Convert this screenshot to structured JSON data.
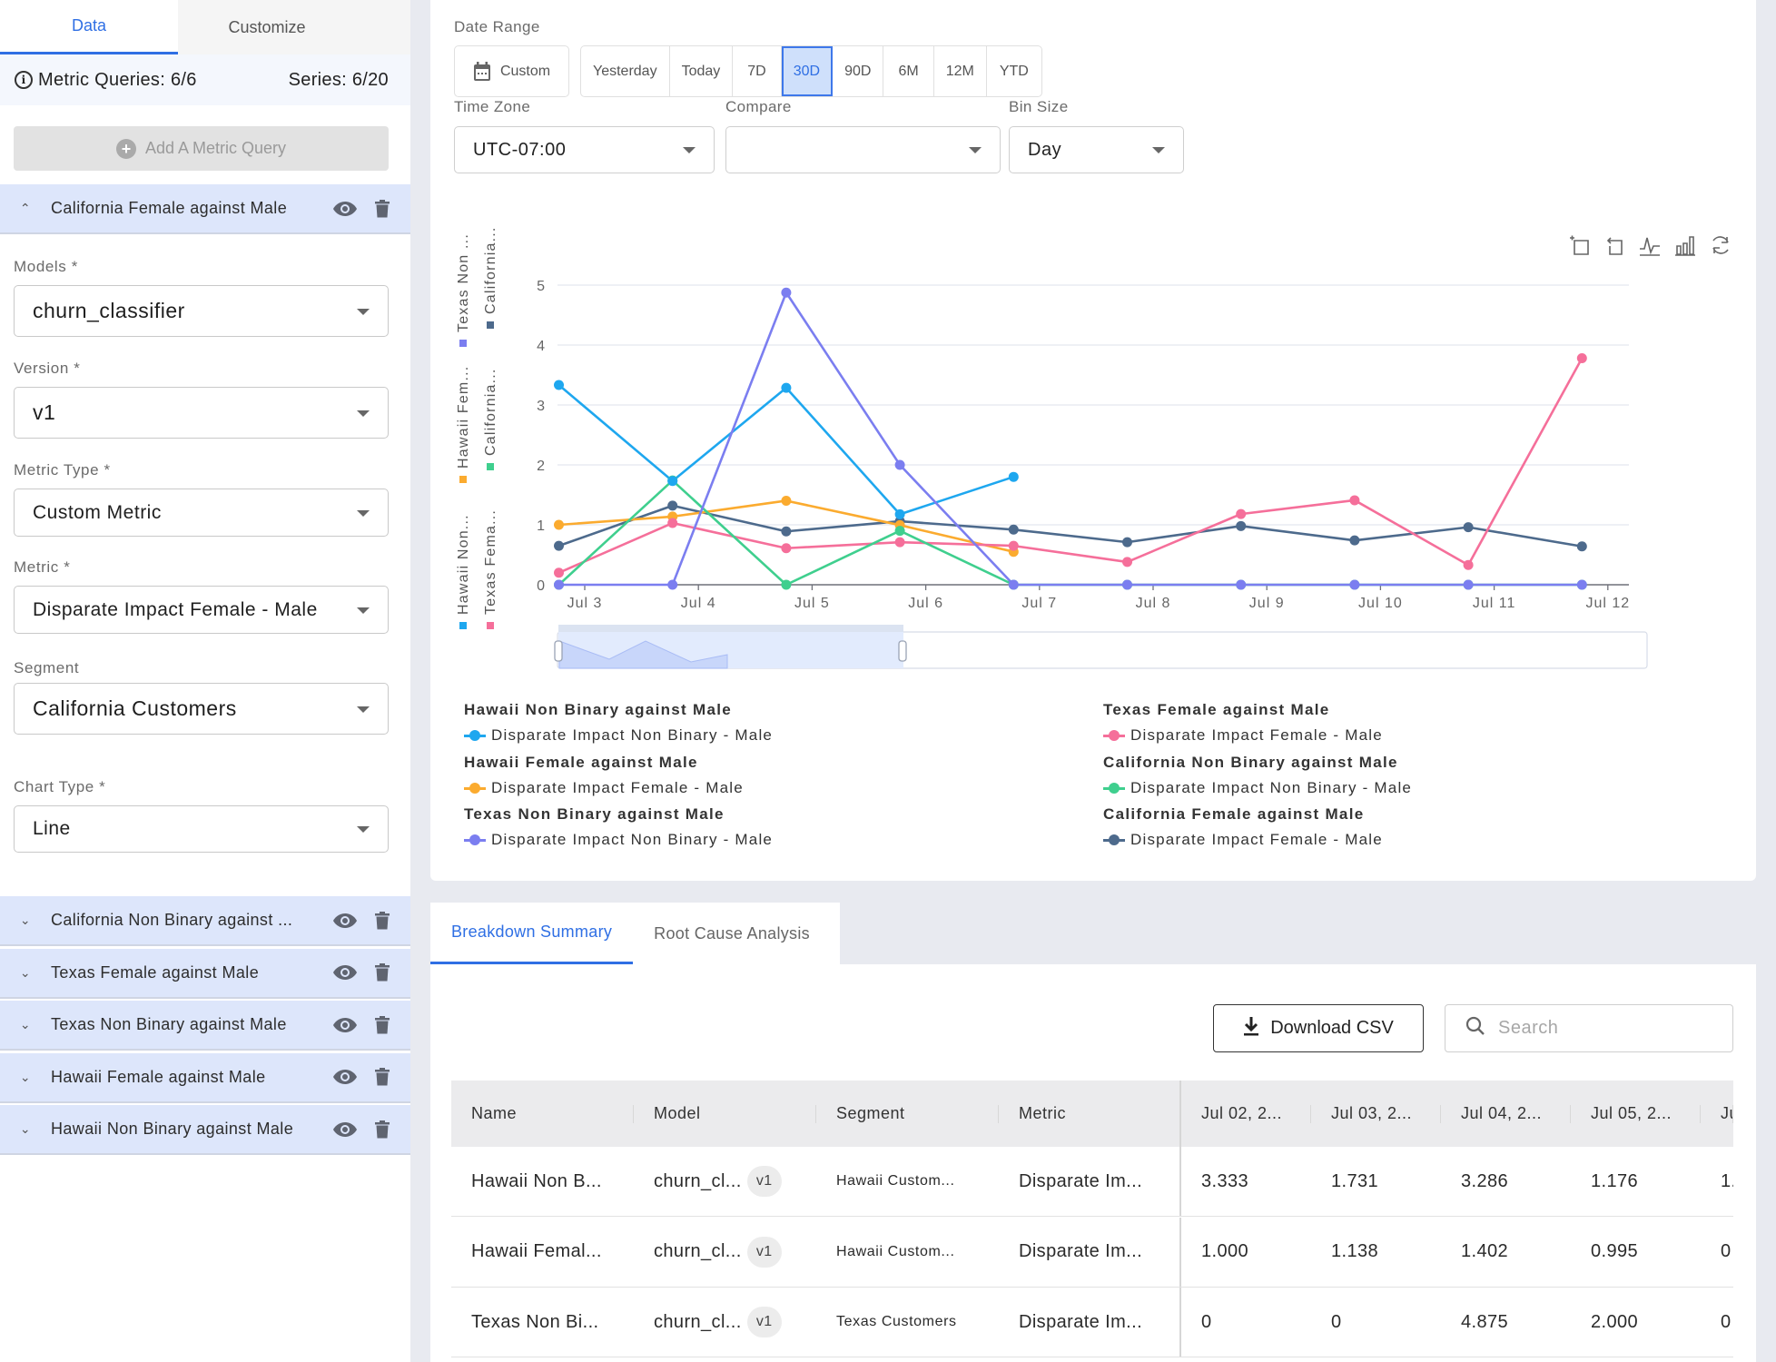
{
  "sidebar": {
    "tabs": [
      {
        "label": "Data",
        "active": true
      },
      {
        "label": "Customize",
        "active": false
      }
    ],
    "metric_queries": "Metric Queries: 6/6",
    "series": "Series: 6/20",
    "add_query_label": "Add A Metric Query",
    "expanded_query": {
      "title": "California Female against Male",
      "fields": [
        {
          "label": "Models *",
          "value": "churn_classifier"
        },
        {
          "label": "Version *",
          "value": "v1"
        },
        {
          "label": "Metric Type *",
          "value": "Custom Metric"
        },
        {
          "label": "Metric *",
          "value": "Disparate Impact Female - Male"
        },
        {
          "label": "Segment",
          "value": "California Customers"
        },
        {
          "label": "Chart Type *",
          "value": "Line"
        }
      ]
    },
    "collapsed_queries": [
      "California Non Binary against ...",
      "Texas Female against Male",
      "Texas Non Binary against Male",
      "Hawaii Female against Male",
      "Hawaii Non Binary against Male"
    ]
  },
  "controls": {
    "date_range_label": "Date Range",
    "custom_label": "Custom",
    "ranges": [
      "Yesterday",
      "Today",
      "7D",
      "30D",
      "90D",
      "6M",
      "12M",
      "YTD"
    ],
    "active_range": "30D",
    "time_zone_label": "Time Zone",
    "time_zone_value": "UTC-07:00",
    "compare_label": "Compare",
    "compare_value": "",
    "bin_size_label": "Bin Size",
    "bin_size_value": "Day"
  },
  "toolbox": [
    "zoom-icon",
    "zoom-reset-icon",
    "line-chart-icon",
    "bar-chart-icon",
    "restore-icon"
  ],
  "chart_data": {
    "type": "line",
    "title": "",
    "xlabel": "",
    "ylabel": "",
    "x": [
      "Jul 2",
      "Jul 3",
      "Jul 4",
      "Jul 5",
      "Jul 6",
      "Jul 7",
      "Jul 8",
      "Jul 9",
      "Jul 10",
      "Jul 11"
    ],
    "x_tick_labels": [
      "Jul 3",
      "Jul 4",
      "Jul 5",
      "Jul 6",
      "Jul 7",
      "Jul 8",
      "Jul 9",
      "Jul 10",
      "Jul 11",
      "Jul 12"
    ],
    "ylim": [
      0,
      5
    ],
    "y_ticks": [
      0,
      1,
      2,
      3,
      4,
      5
    ],
    "grid": true,
    "vertical_legend": [
      "Hawaii Non...",
      "Hawaii Fem...",
      "Texas Non ...",
      "Texas Fema...",
      "California...",
      "California..."
    ],
    "series": [
      {
        "name": "Hawaii Non Binary against Male",
        "metric": "Disparate Impact Non Binary - Male",
        "color": "#1ea7ef",
        "values": [
          3.333,
          1.731,
          3.286,
          1.176,
          1.8,
          null,
          null,
          null,
          null,
          null
        ]
      },
      {
        "name": "Hawaii Female against Male",
        "metric": "Disparate Impact Female - Male",
        "color": "#fbab2f",
        "values": [
          1.0,
          1.138,
          1.402,
          0.995,
          0.55,
          null,
          null,
          null,
          null,
          null
        ]
      },
      {
        "name": "Texas Non Binary against Male",
        "metric": "Disparate Impact Non Binary - Male",
        "color": "#7b7ef0",
        "values": [
          0,
          0,
          4.875,
          2.0,
          0,
          0,
          0,
          0,
          0,
          0
        ]
      },
      {
        "name": "Texas Female against Male",
        "metric": "Disparate Impact Female - Male",
        "color": "#f56f9a",
        "values": [
          0.2,
          1.03,
          0.61,
          0.71,
          0.65,
          0.38,
          1.18,
          1.41,
          0.33,
          3.78
        ]
      },
      {
        "name": "California Non Binary against Male",
        "metric": "Disparate Impact Non Binary - Male",
        "color": "#3fcf8e",
        "values": [
          0,
          1.74,
          0,
          0.9,
          0,
          0,
          0,
          0,
          0,
          0
        ]
      },
      {
        "name": "California Female against Male",
        "metric": "Disparate Impact Female - Male",
        "color": "#4d6a8c",
        "values": [
          0.65,
          1.32,
          0.89,
          1.06,
          0.92,
          0.71,
          0.98,
          0.74,
          0.96,
          0.64
        ]
      }
    ]
  },
  "bottom": {
    "tabs": [
      {
        "label": "Breakdown Summary",
        "active": true
      },
      {
        "label": "Root Cause Analysis",
        "active": false
      }
    ],
    "download_label": "Download CSV",
    "search_placeholder": "Search",
    "columns": [
      "Name",
      "Model",
      "Segment",
      "Metric",
      "Jul 02, 2...",
      "Jul 03, 2...",
      "Jul 04, 2...",
      "Jul 05, 2...",
      "Ju"
    ],
    "rows": [
      {
        "name": "Hawaii Non B...",
        "model": "churn_cl...",
        "version": "v1",
        "segment": "Hawaii Custom...",
        "metric": "Disparate Im...",
        "values": [
          "3.333",
          "1.731",
          "3.286",
          "1.176",
          "1."
        ]
      },
      {
        "name": "Hawaii Femal...",
        "model": "churn_cl...",
        "version": "v1",
        "segment": "Hawaii Custom...",
        "metric": "Disparate Im...",
        "values": [
          "1.000",
          "1.138",
          "1.402",
          "0.995",
          "0"
        ]
      },
      {
        "name": "Texas Non Bi...",
        "model": "churn_cl...",
        "version": "v1",
        "segment": "Texas Customers",
        "metric": "Disparate Im...",
        "values": [
          "0",
          "0",
          "4.875",
          "2.000",
          "0"
        ]
      }
    ]
  }
}
